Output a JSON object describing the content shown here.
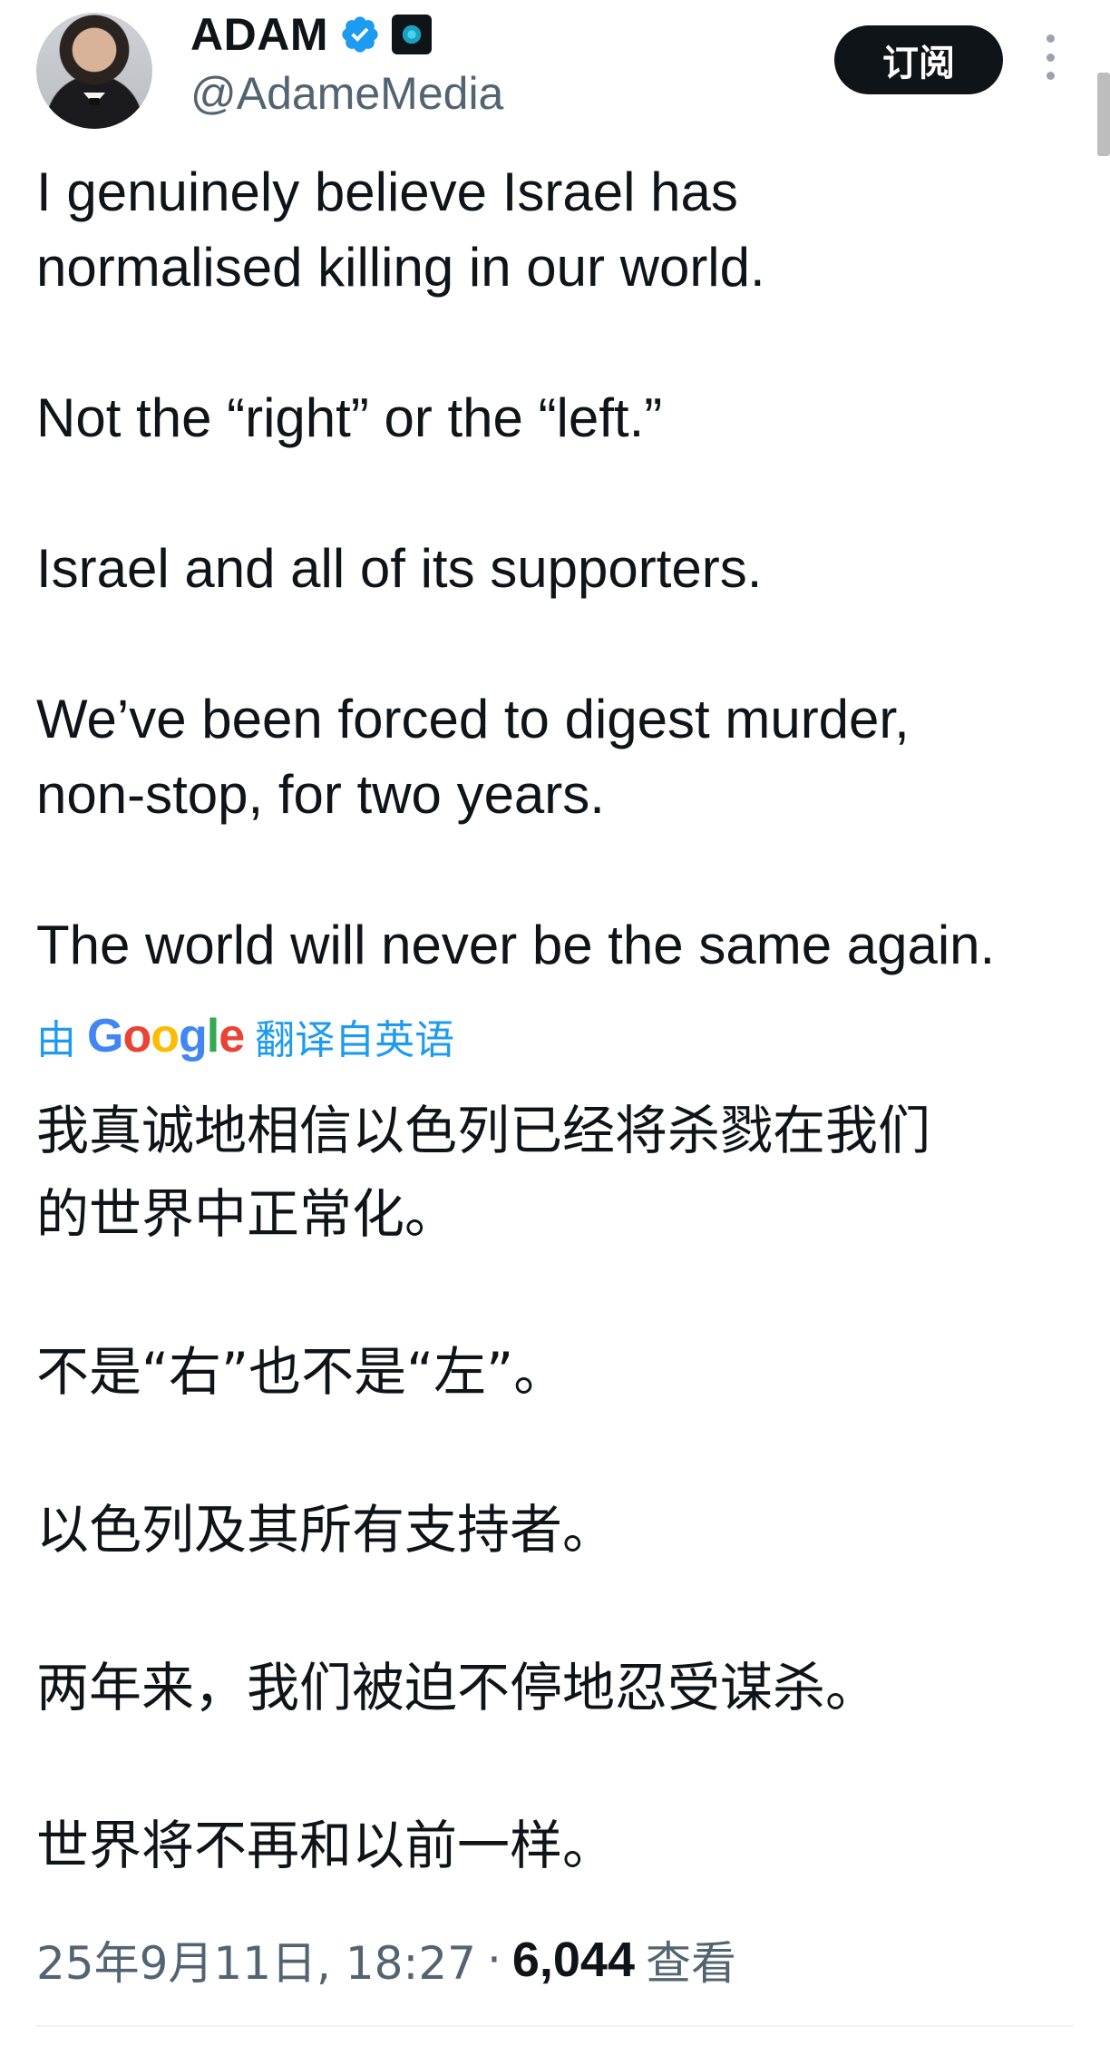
{
  "author": {
    "display_name": "ADAM",
    "handle": "@AdameMedia",
    "verified_icon": "verified-badge-icon",
    "affiliate_icon": "affiliate-badge-icon"
  },
  "header": {
    "subscribe_label": "订阅",
    "more_icon": "more-options-icon"
  },
  "tweet": {
    "paragraphs": [
      "I genuinely believe Israel has\nnormalised killing in our world.",
      "Not the “right” or the “left.”",
      "Israel and all of its supporters.",
      "We’ve been forced to digest murder,\nnon-stop, for two years.",
      "The world will never be the same again."
    ]
  },
  "translation": {
    "prefix": "由",
    "provider": "Google",
    "suffix": "翻译自英语",
    "paragraphs": [
      "我真诚地相信以色列已经将杀戮在我们\n的世界中正常化。",
      "不是“右”也不是“左”。",
      "以色列及其所有支持者。",
      "两年来，我们被迫不停地忍受谋杀。",
      "世界将不再和以前一样。"
    ]
  },
  "meta": {
    "date": "25年9月11日, 18:27",
    "separator": "·",
    "views_count": "6,044",
    "views_label": "查看"
  },
  "colors": {
    "link_blue": "#1d9bf0",
    "text_primary": "#0f1419",
    "text_secondary": "#536471"
  }
}
